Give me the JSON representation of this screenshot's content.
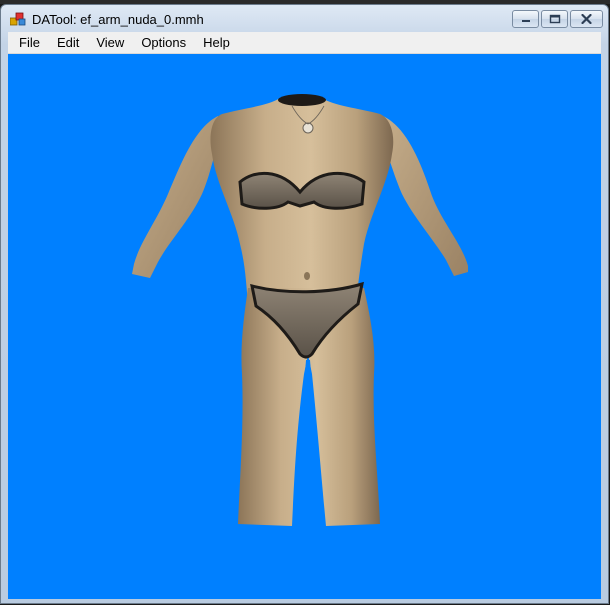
{
  "window": {
    "title": "DATool: ef_arm_nuda_0.mmh",
    "app_icon": "datool-app-icon",
    "controls": [
      "minimize-icon",
      "maximize-icon",
      "close-icon"
    ]
  },
  "menu": {
    "items": [
      {
        "label": "File"
      },
      {
        "label": "Edit"
      },
      {
        "label": "View"
      },
      {
        "label": "Options"
      },
      {
        "label": "Help"
      }
    ]
  },
  "viewport": {
    "background_color": "#0080ff",
    "content": "3d-model-render",
    "skin_color": "#c9b08c",
    "garment_color": "#2a2622"
  }
}
